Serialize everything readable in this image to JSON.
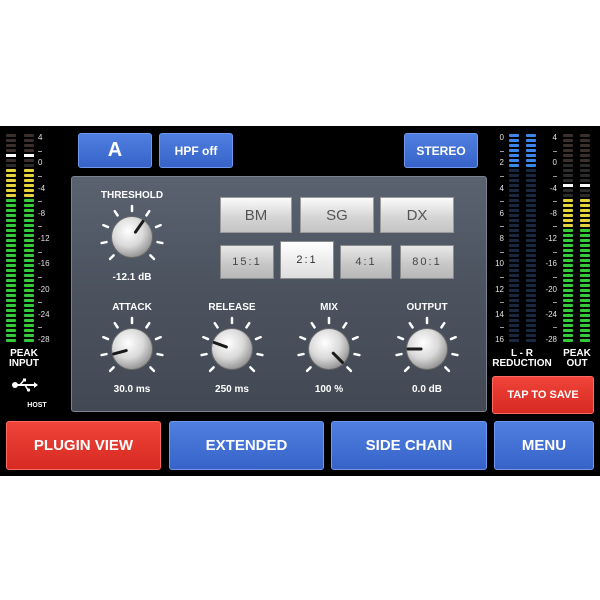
{
  "top": {
    "preset_label": "A",
    "hpf_label": "HPF off",
    "stereo_label": "STEREO"
  },
  "meters": {
    "scale": [
      "4",
      "0",
      "-4",
      "-8",
      "-12",
      "-16",
      "-20",
      "-24",
      "-28"
    ],
    "reduction_scale": [
      "0",
      "2",
      "4",
      "6",
      "8",
      "10",
      "12",
      "14",
      "16"
    ],
    "peak_input_label": [
      "PEAK",
      "INPUT"
    ],
    "host_label": "HOST",
    "reduction_label": [
      "L - R",
      "REDUCTION"
    ],
    "peak_out_label": [
      "PEAK",
      "OUT"
    ],
    "input_level_fraction": 0.83,
    "output_level_fraction": 0.7
  },
  "panel": {
    "threshold": {
      "label": "THRESHOLD",
      "value": "-12.1 dB"
    },
    "attack": {
      "label": "ATTACK",
      "value": "30.0 ms"
    },
    "release": {
      "label": "RELEASE",
      "value": "250 ms"
    },
    "mix": {
      "label": "MIX",
      "value": "100 %"
    },
    "output": {
      "label": "OUTPUT",
      "value": "0.0 dB"
    },
    "modes": [
      "BM",
      "SG",
      "DX"
    ],
    "ratios": [
      "15:1",
      "2:1",
      "4:1",
      "80:1"
    ],
    "selected_ratio": "2:1"
  },
  "tap_to_save": "TAP TO SAVE",
  "nav": {
    "plugin_view": "PLUGIN VIEW",
    "extended": "EXTENDED",
    "side_chain": "SIDE CHAIN",
    "menu": "MENU"
  },
  "colors": {
    "accent_blue": "#3f6fd6",
    "accent_red": "#e2372e",
    "meter_green": "#36c93a",
    "meter_yellow": "#e6d23a",
    "reduction_blue": "#3b86e8"
  }
}
